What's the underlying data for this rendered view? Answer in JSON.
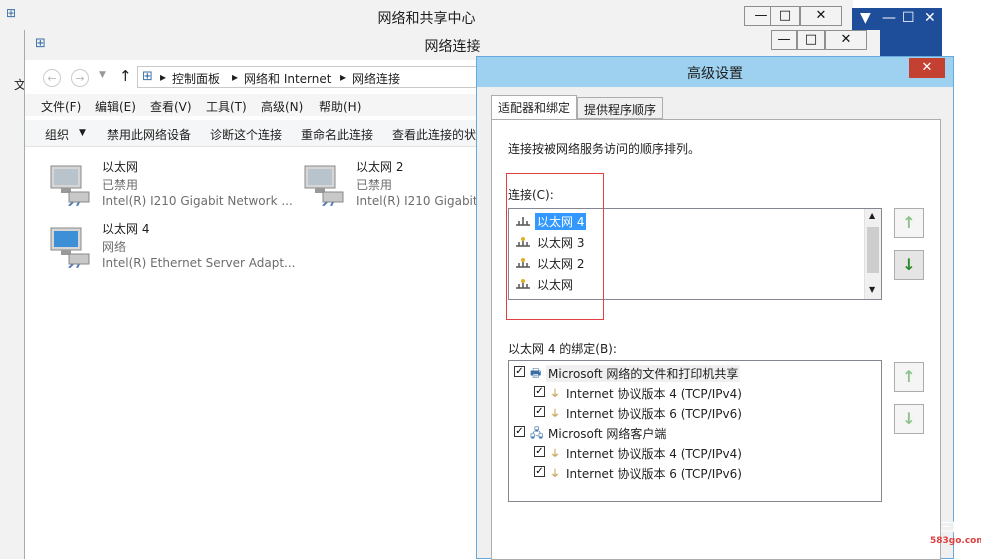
{
  "nsc_window": {
    "title": "网络和共享中心",
    "left_char": "文"
  },
  "nc_window": {
    "title": "网络连接",
    "breadcrumb": [
      "控制面板",
      "网络和 Internet",
      "网络连接"
    ],
    "menu": [
      "文件(F)",
      "编辑(E)",
      "查看(V)",
      "工具(T)",
      "高级(N)",
      "帮助(H)"
    ],
    "toolbar": [
      "组织",
      "禁用此网络设备",
      "诊断这个连接",
      "重命名此连接",
      "查看此连接的状"
    ],
    "adapters": [
      {
        "name": "以太网",
        "status": "已禁用",
        "device": "Intel(R) I210 Gigabit Network ..."
      },
      {
        "name": "以太网 2",
        "status": "已禁用",
        "device": "Intel(R) I210 Gigabit"
      },
      {
        "name": "以太网 4",
        "status": "网络",
        "device": "Intel(R) Ethernet Server Adapt..."
      }
    ]
  },
  "dialog": {
    "title": "高级设置",
    "close": "✕",
    "tabs": [
      "适配器和绑定",
      "提供程序顺序"
    ],
    "instruction": "连接按被网络服务访问的顺序排列。",
    "connections_label": "连接(C):",
    "connections": [
      "以太网 4",
      "以太网 3",
      "以太网 2",
      "以太网"
    ],
    "bindings_label": "以太网 4 的绑定(B):",
    "bindings": [
      {
        "label": "Microsoft 网络的文件和打印机共享",
        "level": 0
      },
      {
        "label": "Internet 协议版本 4 (TCP/IPv4)",
        "level": 1
      },
      {
        "label": "Internet 协议版本 6 (TCP/IPv6)",
        "level": 1
      },
      {
        "label": "Microsoft 网络客户端",
        "level": 0
      },
      {
        "label": "Internet 协议版本 4 (TCP/IPv4)",
        "level": 1
      },
      {
        "label": "Internet 协议版本 6 (TCP/IPv6)",
        "level": 1
      }
    ]
  },
  "colors": {
    "accent_blue": "#1e4e9a",
    "dialog_title": "#9ed1ef",
    "selection": "#3399ff",
    "highlight_box": "#e04040"
  },
  "watermark": {
    "line1": "三国",
    "line2": "583go.com"
  }
}
